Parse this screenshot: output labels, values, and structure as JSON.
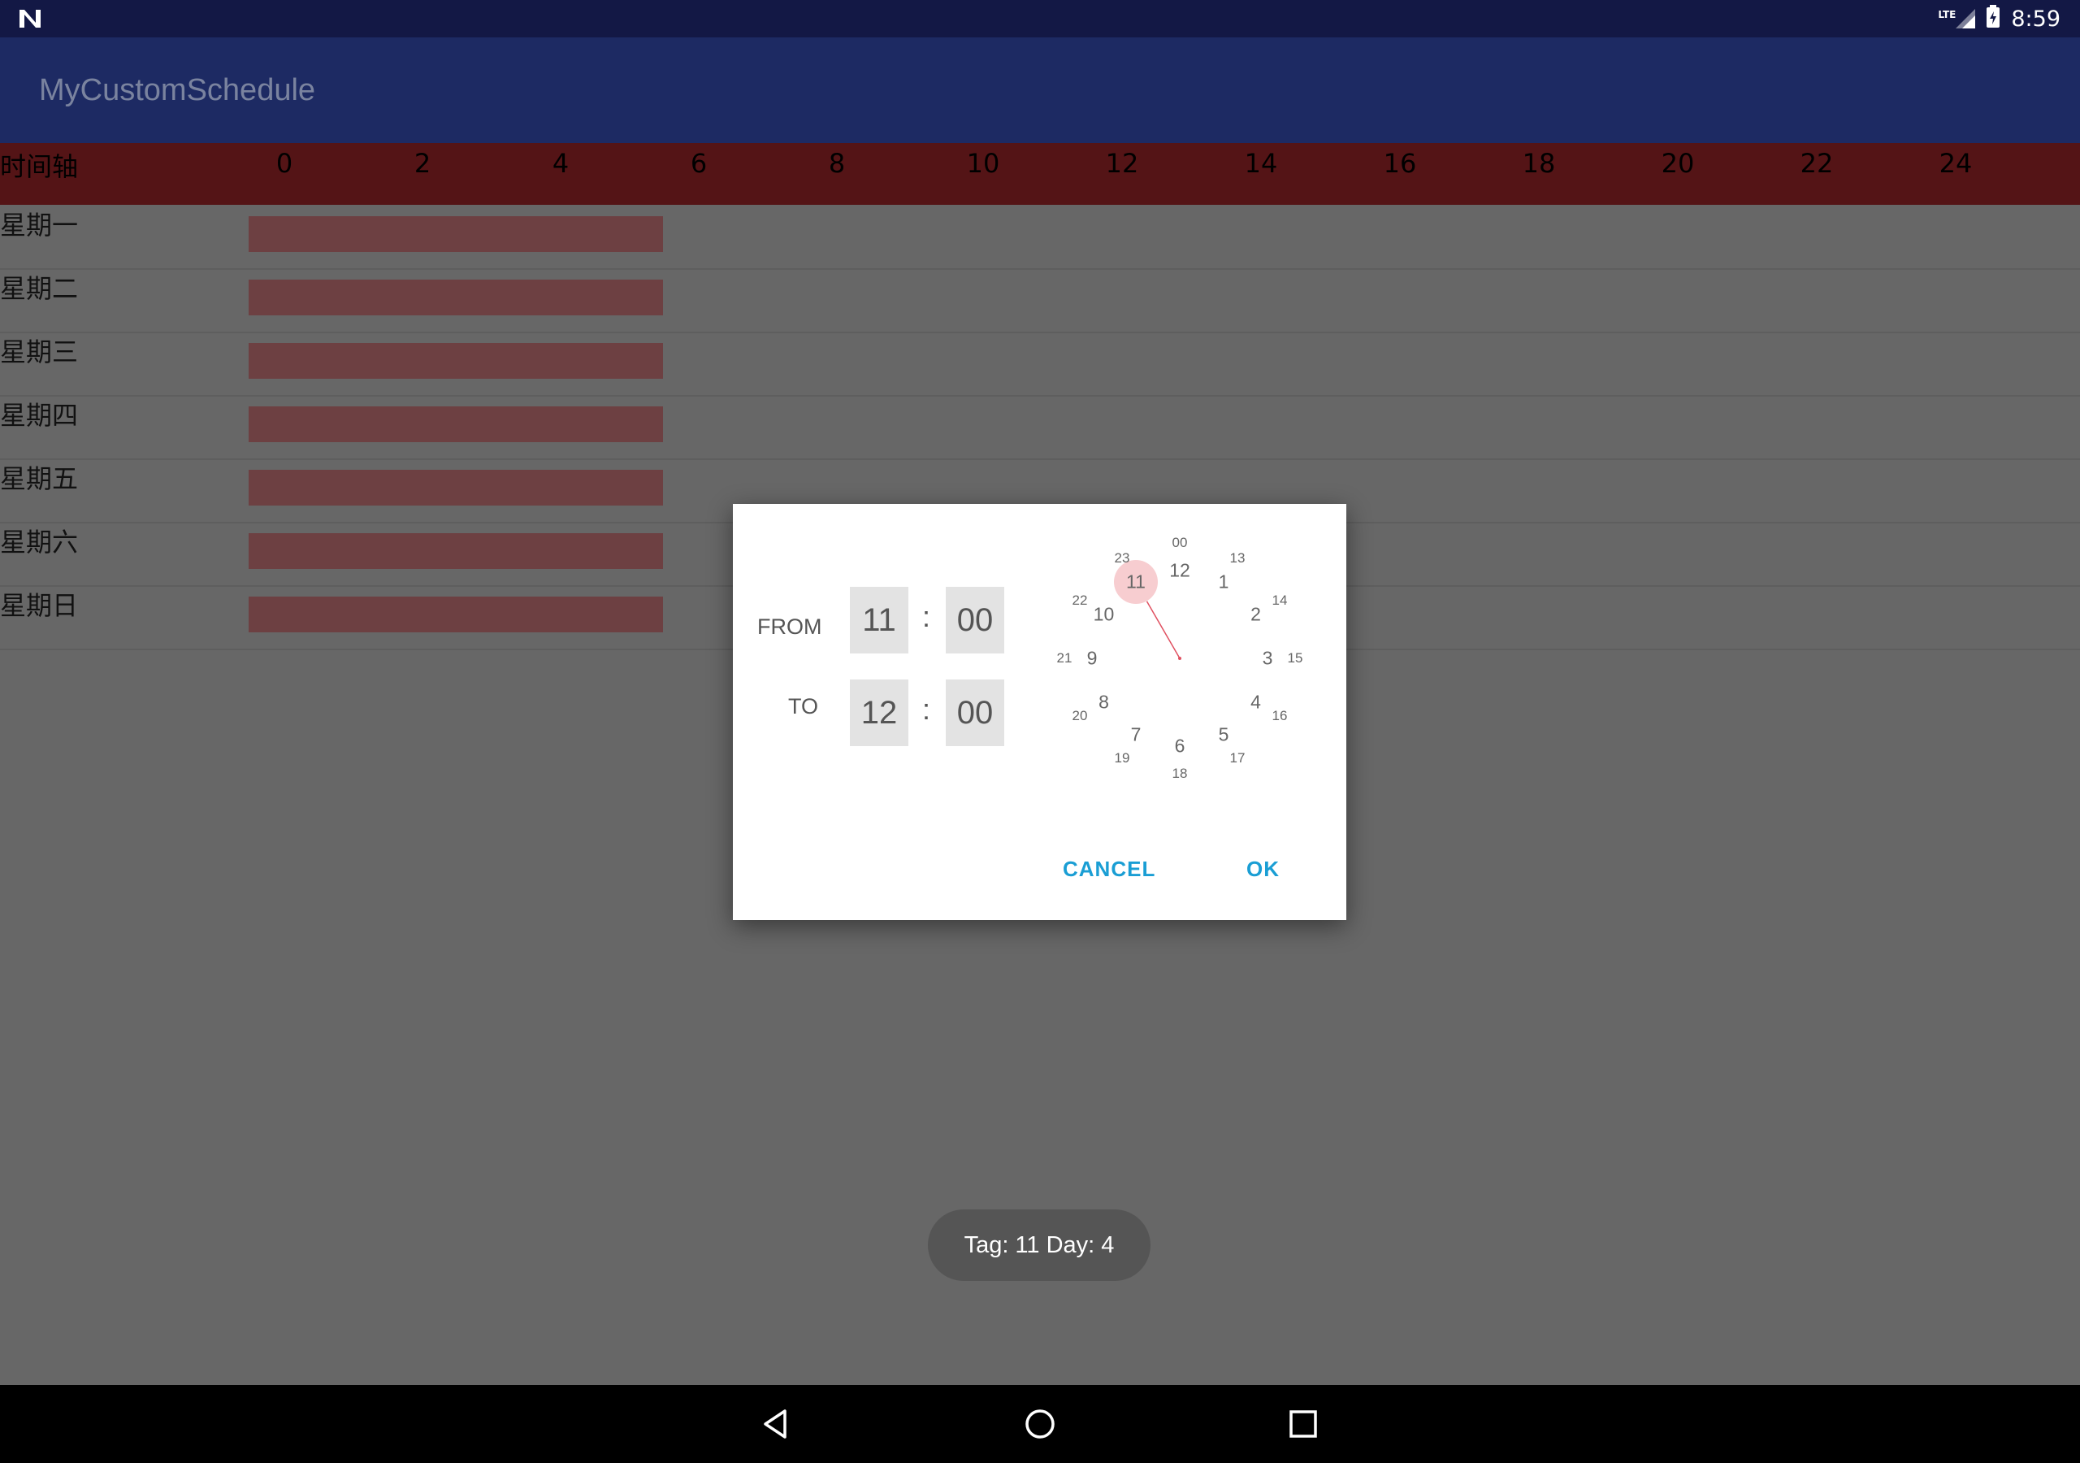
{
  "status_bar": {
    "time": "8:59",
    "network": "LTE",
    "icons": [
      "notification-n-icon",
      "lte-signal-icon",
      "battery-charging-icon"
    ]
  },
  "app_bar": {
    "title": "MyCustomSchedule"
  },
  "schedule": {
    "axis_label": "时间轴",
    "ticks": [
      "0",
      "2",
      "4",
      "6",
      "8",
      "10",
      "12",
      "14",
      "16",
      "18",
      "20",
      "22",
      "24"
    ],
    "days": [
      "星期一",
      "星期二",
      "星期三",
      "星期四",
      "星期五",
      "星期六",
      "星期日"
    ],
    "bar_start_hour": 0,
    "bar_end_hour": 6,
    "colors": {
      "header": "#541416",
      "bar": "#6d4042"
    }
  },
  "dialog": {
    "from_label": "FROM",
    "to_label": "TO",
    "from_hour": "11",
    "from_minute": "00",
    "to_hour": "12",
    "to_minute": "00",
    "colon": ":",
    "clock": {
      "selected_hour": 11,
      "outer": [
        "12",
        "1",
        "2",
        "3",
        "4",
        "5",
        "6",
        "7",
        "8",
        "9",
        "10",
        "11"
      ],
      "inner": [
        "00",
        "13",
        "14",
        "15",
        "16",
        "17",
        "18",
        "19",
        "20",
        "21",
        "22",
        "23"
      ]
    },
    "cancel": "CANCEL",
    "ok": "OK",
    "accent": "#1a9ed4"
  },
  "toast": {
    "text": "Tag: 11 Day: 4"
  },
  "nav_bar": {
    "buttons": [
      "back-icon",
      "home-icon",
      "recents-icon"
    ]
  }
}
